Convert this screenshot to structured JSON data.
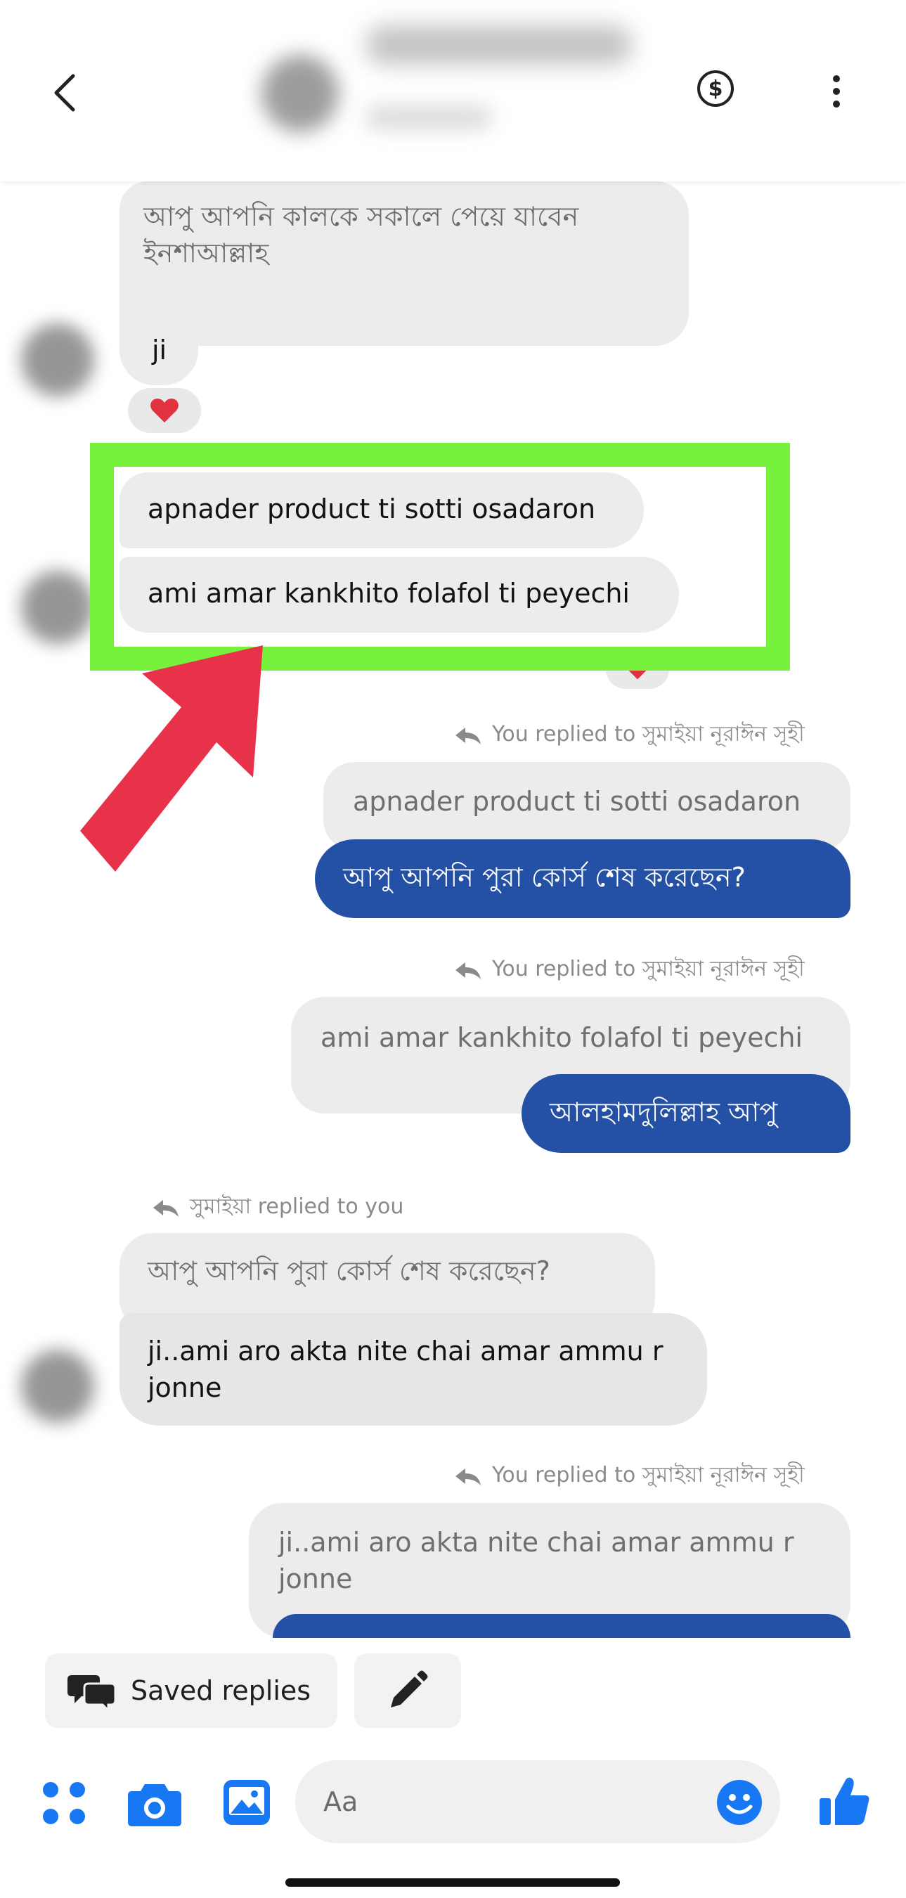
{
  "header": {
    "back_icon": "chevron-left-icon",
    "payment_icon": "dollar-circle-icon",
    "more_icon": "vertical-dots-icon"
  },
  "messages": {
    "m1": "আপু আপনি কালকে সকালে পেয়ে যাবেন ইনশাআল্লাহ",
    "m2": "ji",
    "m3": "apnader product ti sotti osadaron",
    "m4": "ami amar kankhito folafol ti peyechi",
    "reply1_note": "You replied to সুমাইয়া নূরাঈন সূহী",
    "reply1_quote": "apnader product ti sotti osadaron",
    "reply1_text": "আপু আপনি পুরা কোর্স শেষ করেছেন?",
    "reply2_note": "You replied to সুমাইয়া নূরাঈন সূহী",
    "reply2_quote": "ami amar kankhito folafol ti peyechi",
    "reply2_text": "আলহামদুলিল্লাহ আপু",
    "reply3_note": "সুমাইয়া replied to you",
    "reply3_quote": "আপু আপনি পুরা কোর্স শেষ করেছেন?",
    "reply3_text": "ji..ami aro akta nite chai amar ammu r jonne",
    "reply4_note": "You replied to সুমাইয়া নূরাঈন সূহী",
    "reply4_quote": "ji..ami aro akta nite chai amar ammu r jonne"
  },
  "quick_replies": {
    "saved_label": "Saved replies"
  },
  "composer": {
    "placeholder": "Aa"
  },
  "colors": {
    "outgoing_bubble": "#2451a5",
    "incoming_bubble": "#ececec",
    "highlight": "#76f23c",
    "arrow": "#e8324a",
    "accent": "#1877f2"
  }
}
